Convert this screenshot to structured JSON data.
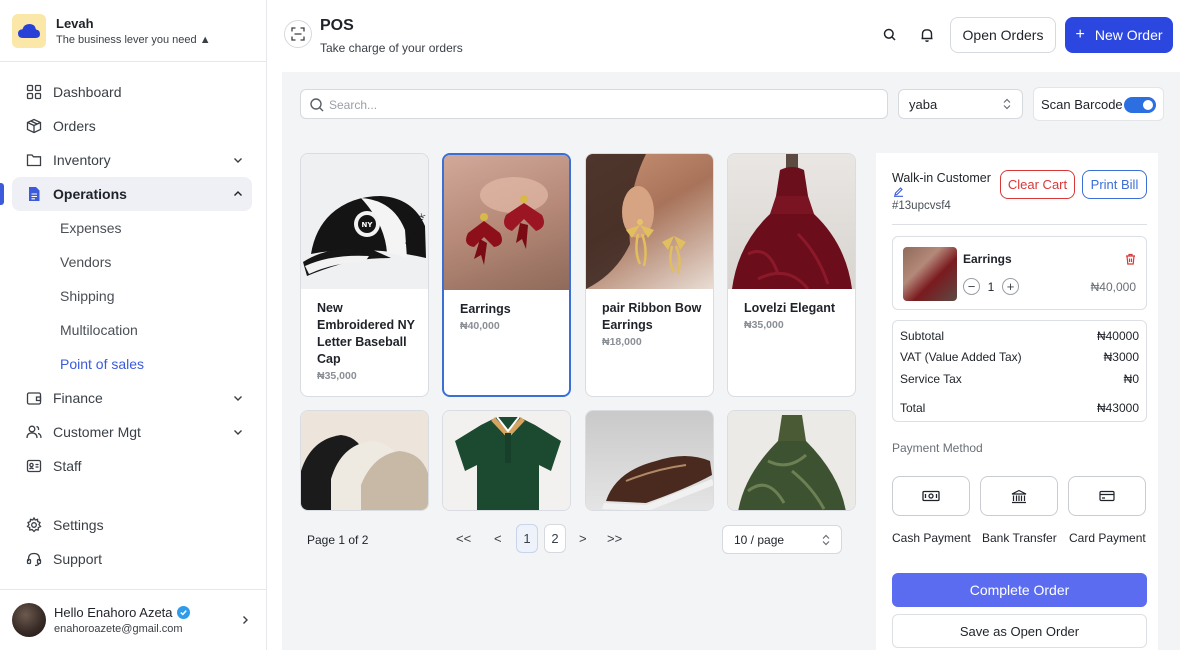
{
  "brand": {
    "name": "Levah",
    "tagline": "The business lever you need ▲"
  },
  "sidebar": {
    "items": [
      {
        "label": "Dashboard",
        "icon": "grid-icon"
      },
      {
        "label": "Orders",
        "icon": "box-icon"
      },
      {
        "label": "Inventory",
        "icon": "folder-icon",
        "expandable": true
      },
      {
        "label": "Operations",
        "icon": "document-icon",
        "expanded": true,
        "active": true
      }
    ],
    "operations_sub": [
      {
        "label": "Expenses"
      },
      {
        "label": "Vendors"
      },
      {
        "label": "Shipping"
      },
      {
        "label": "Multilocation"
      },
      {
        "label": "Point of sales",
        "current": true
      }
    ],
    "items_after": [
      {
        "label": "Finance",
        "icon": "wallet-icon"
      },
      {
        "label": "Customer Mgt",
        "icon": "users-icon"
      },
      {
        "label": "Staff",
        "icon": "id-card-icon"
      }
    ],
    "bottom": [
      {
        "label": "Settings",
        "icon": "gear-icon"
      },
      {
        "label": "Support",
        "icon": "headset-icon"
      }
    ]
  },
  "user": {
    "greeting": "Hello Enahoro Azeta",
    "email": "enahoroazete@gmail.com"
  },
  "header": {
    "title": "POS",
    "subtitle": "Take charge of your orders",
    "open_orders_label": "Open Orders",
    "new_order_label": "New Order"
  },
  "toolbar": {
    "search_placeholder": "Search...",
    "location": "yaba",
    "scan_label": "Scan Barcode",
    "scan_enabled": true
  },
  "products": [
    {
      "name": "New Embroidered NY Letter Baseball Cap",
      "price": "₦35,000"
    },
    {
      "name": "Earrings",
      "price": "₦40,000",
      "selected": true
    },
    {
      "name": "pair Ribbon Bow Earrings",
      "price": "₦18,000"
    },
    {
      "name": "Lovelzi Elegant",
      "price": "₦35,000"
    }
  ],
  "pagination": {
    "label": "Page 1 of 2",
    "first": "<<",
    "prev": "<",
    "pages": [
      "1",
      "2"
    ],
    "current": "1",
    "next": ">",
    "last": ">>",
    "per_page": "10 / page"
  },
  "cart": {
    "customer": "Walk-in Customer",
    "customer_id": "#13upcvsf4",
    "clear_label": "Clear Cart",
    "print_label": "Print Bill",
    "items": [
      {
        "name": "Earrings",
        "qty": "1",
        "price": "₦40,000"
      }
    ],
    "totals": {
      "subtotal_label": "Subtotal",
      "subtotal": "₦40000",
      "vat_label": "VAT (Value Added Tax)",
      "vat": "₦3000",
      "service_label": "Service Tax",
      "service": "₦0",
      "total_label": "Total",
      "total": "₦43000"
    },
    "payment_method_label": "Payment Method",
    "payment_methods": [
      {
        "label": "Cash Payment",
        "icon": "cash-icon"
      },
      {
        "label": "Bank Transfer",
        "icon": "bank-icon"
      },
      {
        "label": "Card Payment",
        "icon": "card-icon"
      }
    ],
    "complete_label": "Complete Order",
    "save_label": "Save as Open Order"
  },
  "colors": {
    "primary": "#2c47e0",
    "accent_link": "#3b5bdb",
    "danger": "#d93838",
    "complete": "#5b6cf0"
  }
}
